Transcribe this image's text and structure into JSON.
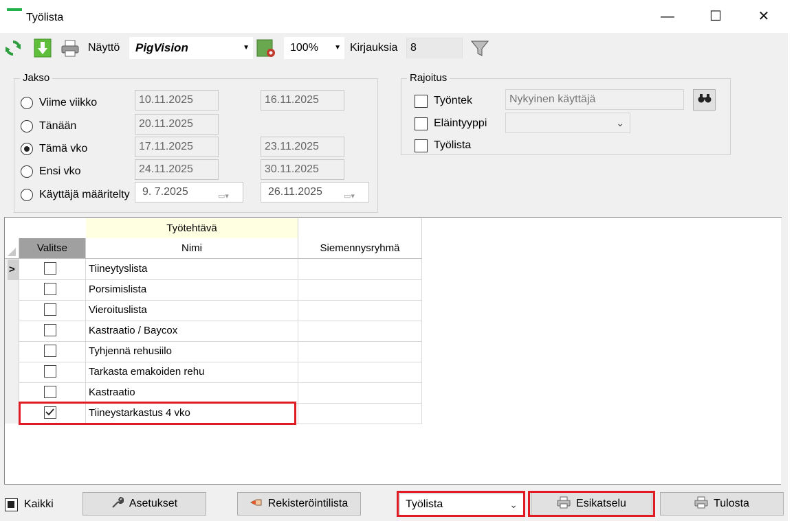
{
  "window": {
    "title": "Työlista",
    "minimize_glyph": "—",
    "maximize_glyph": "☐",
    "close_glyph": "✕"
  },
  "toolbar": {
    "naytto_label": "Näyttö",
    "naytto_value": "PigVision",
    "zoom_value": "100%",
    "kirjauksia_label": "Kirjauksia",
    "kirjauksia_value": "8"
  },
  "jakso": {
    "title": "Jakso",
    "options": [
      {
        "label": "Viime viikko",
        "selected": false,
        "from": "10.11.2025",
        "to": "16.11.2025"
      },
      {
        "label": "Tänään",
        "selected": false,
        "from": "20.11.2025",
        "to": ""
      },
      {
        "label": "Tämä vko",
        "selected": true,
        "from": "17.11.2025",
        "to": "23.11.2025"
      },
      {
        "label": "Ensi vko",
        "selected": false,
        "from": "24.11.2025",
        "to": "30.11.2025"
      },
      {
        "label": "Käyttäjä määritelty",
        "selected": false,
        "from": "9.  7.2025",
        "to": "26.11.2025"
      }
    ]
  },
  "rajoitus": {
    "title": "Rajoitus",
    "tyontek_label": "Työntek",
    "tyontek_value": "Nykyinen käyttäjä",
    "elaintyyppi_label": "Eläintyyppi",
    "tyolista_label": "Työlista"
  },
  "grid": {
    "group_header": "Työtehtävä",
    "columns": [
      "Valitse",
      "Nimi",
      "Siemennysryhmä"
    ],
    "row_indicator": ">",
    "rows": [
      {
        "checked": false,
        "name": "Tiineytyslista",
        "group": ""
      },
      {
        "checked": false,
        "name": "Porsimislista",
        "group": ""
      },
      {
        "checked": false,
        "name": "Vieroituslista",
        "group": ""
      },
      {
        "checked": false,
        "name": "Kastraatio / Baycox",
        "group": ""
      },
      {
        "checked": false,
        "name": "Tyhjennä rehusiilo",
        "group": ""
      },
      {
        "checked": false,
        "name": "Tarkasta emakoiden rehu",
        "group": ""
      },
      {
        "checked": false,
        "name": "Kastraatio",
        "group": ""
      },
      {
        "checked": true,
        "name": "Tiineystarkastus 4 vko",
        "group": ""
      }
    ]
  },
  "bottom": {
    "kaikki_label": "Kaikki",
    "asetukset_label": "Asetukset",
    "rekisterointilista_label": "Rekisteröintilista",
    "report_select_value": "Työlista",
    "esikatselu_label": "Esikatselu",
    "tulosta_label": "Tulosta"
  },
  "colors": {
    "highlight": "#e01b24",
    "header_yellow": "#ffffe1",
    "selected_header": "#a0a0a0"
  }
}
